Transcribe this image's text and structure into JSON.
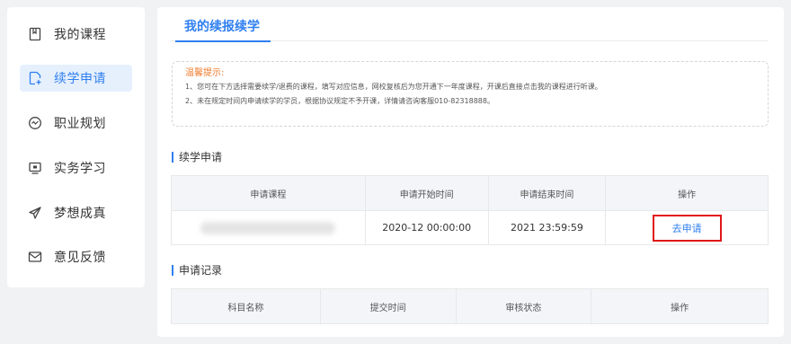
{
  "sidebar": {
    "items": [
      {
        "label": "我的课程",
        "icon": "book-icon",
        "active": false
      },
      {
        "label": "续学申请",
        "icon": "document-add-icon",
        "active": true
      },
      {
        "label": "职业规划",
        "icon": "compass-icon",
        "active": false
      },
      {
        "label": "实务学习",
        "icon": "monitor-icon",
        "active": false
      },
      {
        "label": "梦想成真",
        "icon": "paper-plane-icon",
        "active": false
      },
      {
        "label": "意见反馈",
        "icon": "mail-icon",
        "active": false
      }
    ]
  },
  "main": {
    "tab": "我的续报续学",
    "notice": {
      "title": "温馨提示:",
      "lines": [
        "1、您可在下方选择需要续学/退费的课程，填写对应信息，网校复核后为您开通下一年度课程，开课后直接点击我的课程进行听课。",
        "2、未在规定时间内申请续学的学员，根据协议规定不予开课，详情请咨询客服010-82318888。"
      ]
    },
    "apply_section": {
      "title": "续学申请",
      "headers": [
        "申请课程",
        "申请开始时间",
        "申请结束时间",
        "操作"
      ],
      "row": {
        "course": "",
        "start_time": "2020-12 00:00:00",
        "end_time": "2021 23:59:59",
        "action": "去申请"
      }
    },
    "records_section": {
      "title": "申请记录",
      "headers": [
        "科目名称",
        "提交时间",
        "审核状态",
        "操作"
      ]
    }
  },
  "colors": {
    "accent": "#2f7ff0",
    "warning": "#f07b2b",
    "highlight_border": "#e01818",
    "background": "#f1f2f4"
  }
}
